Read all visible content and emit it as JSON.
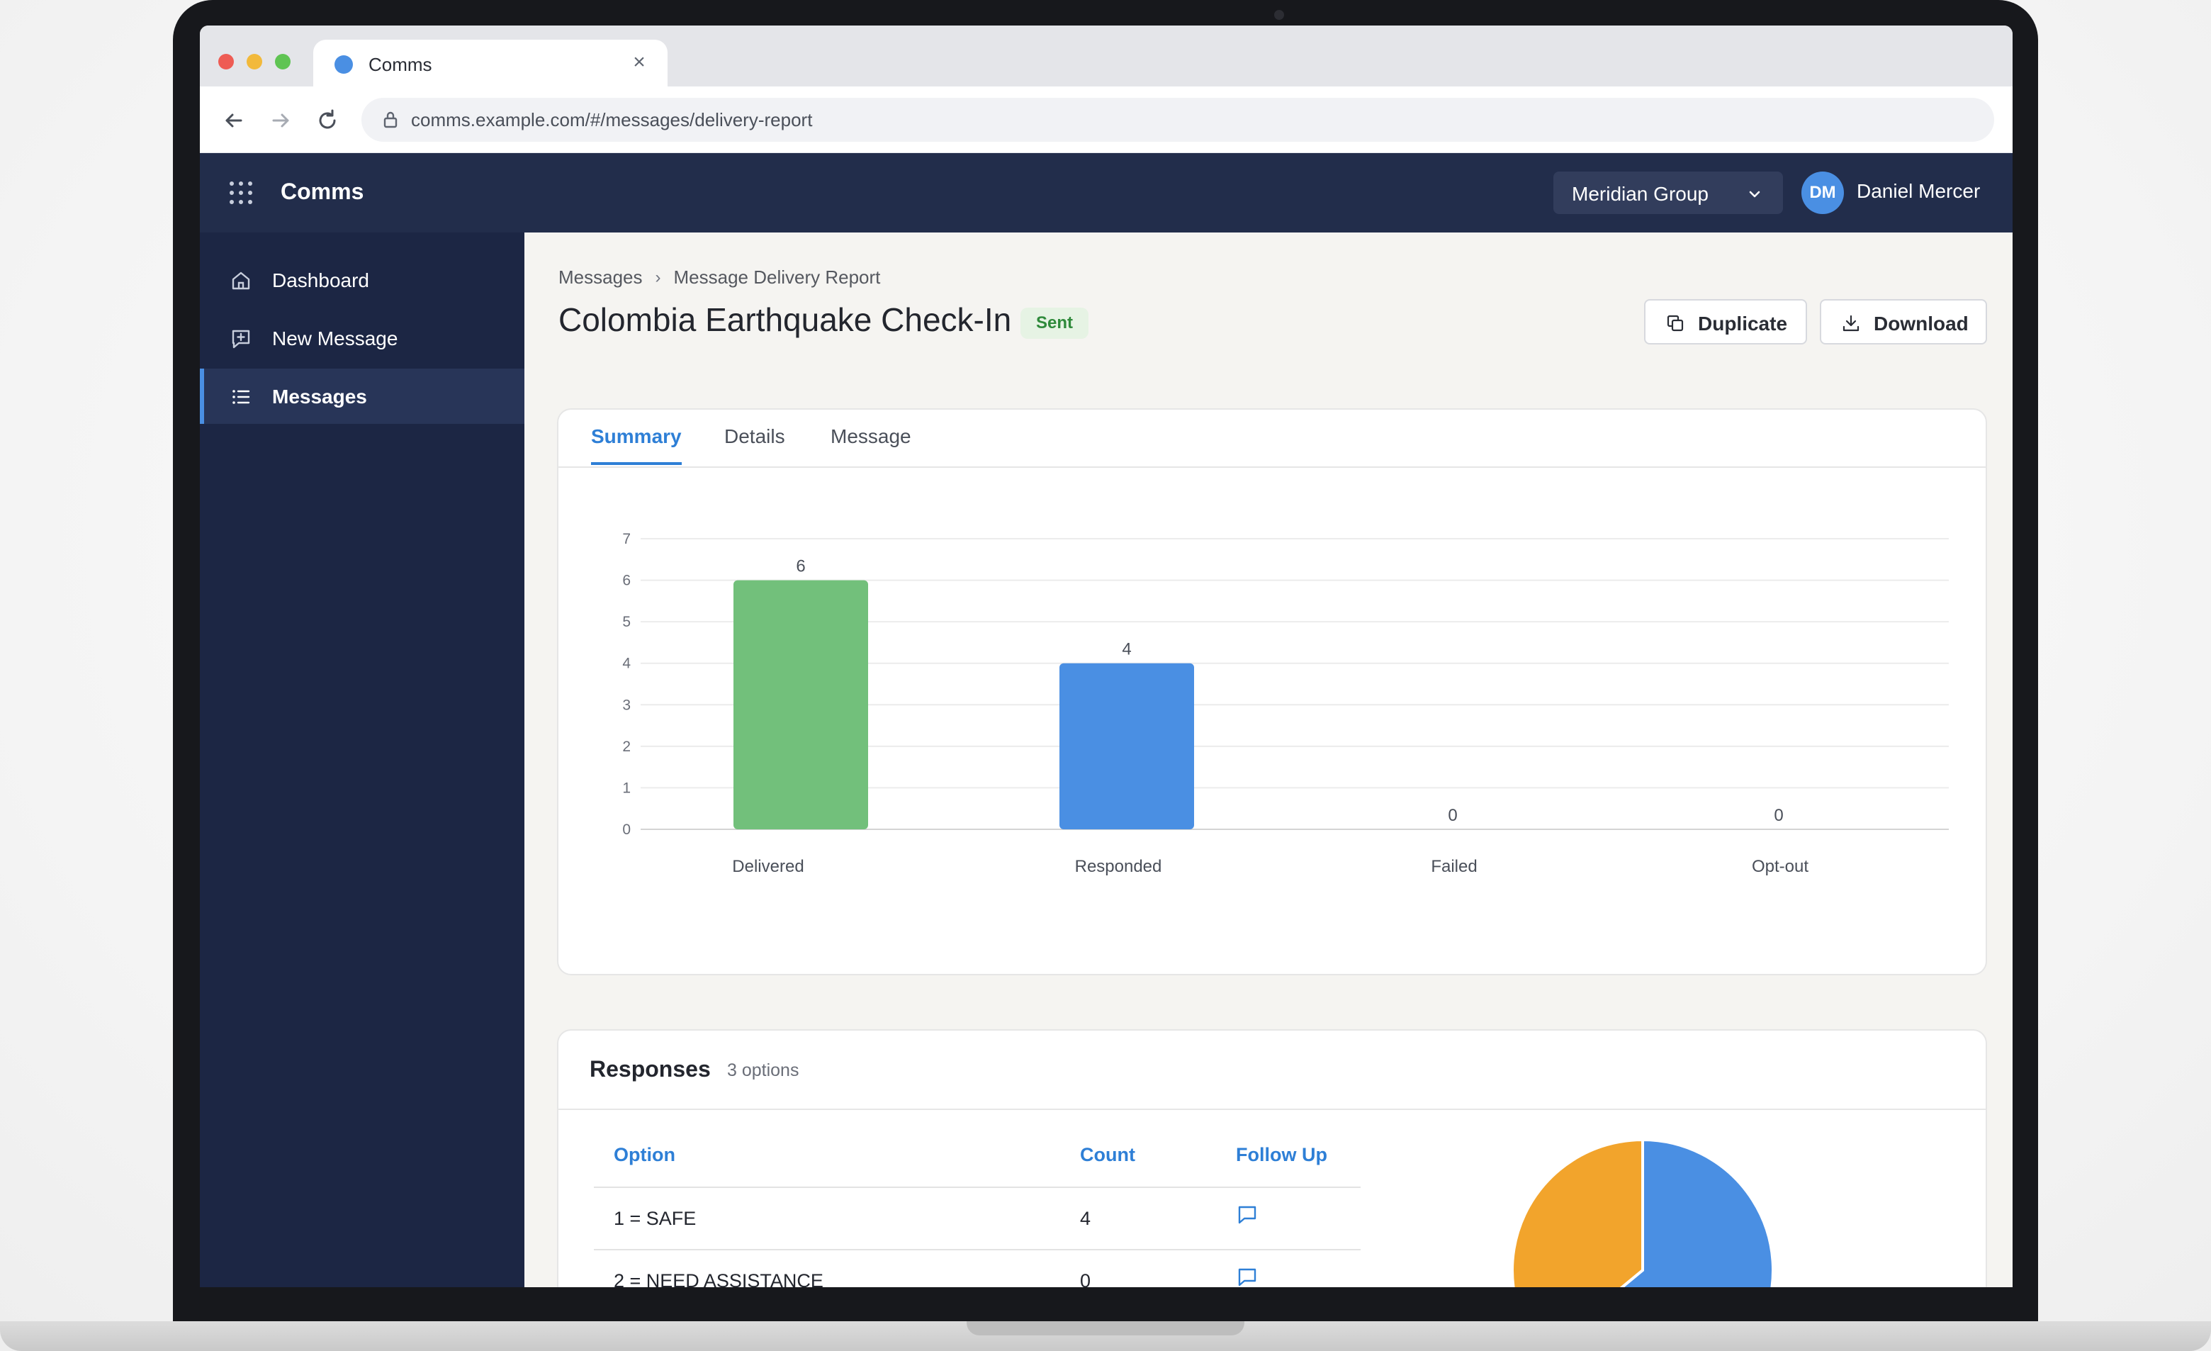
{
  "browser": {
    "tab_title": "Comms",
    "url": "comms.example.com/#/messages/delivery-report"
  },
  "header": {
    "app_name": "Comms",
    "org": "Meridian Group",
    "user_initials": "DM",
    "user_name": "Daniel Mercer"
  },
  "sidebar": {
    "items": [
      {
        "label": "Dashboard",
        "icon": "home-icon",
        "active": false
      },
      {
        "label": "New Message",
        "icon": "message-plus-icon",
        "active": false
      },
      {
        "label": "Messages",
        "icon": "list-icon",
        "active": true
      }
    ]
  },
  "page": {
    "breadcrumb": [
      "Messages",
      "Message Delivery Report"
    ],
    "breadcrumb_separator": "›",
    "title": "Colombia Earthquake Check-In",
    "status": "Sent",
    "actions": {
      "duplicate": "Duplicate",
      "download": "Download"
    },
    "tabs": [
      "Summary",
      "Details",
      "Message"
    ],
    "active_tab": "Summary"
  },
  "chart_data": [
    {
      "type": "bar",
      "categories": [
        "Delivered",
        "Responded",
        "Failed",
        "Opt-out"
      ],
      "values": [
        6,
        4,
        0,
        0
      ],
      "colors": [
        "#72c07b",
        "#4a8fe3",
        "#4a8fe3",
        "#4a8fe3"
      ],
      "ylim": [
        0,
        7
      ],
      "yticks": [
        0,
        1,
        2,
        3,
        4,
        5,
        6,
        7
      ],
      "grid": true
    },
    {
      "type": "pie",
      "categories": [
        "1 = SAFE",
        "2 = NEED ASSISTANCE"
      ],
      "values": [
        4,
        0
      ],
      "colors": [
        "#4a8fe3",
        "#f2a42c"
      ],
      "partially_visible": true
    }
  ],
  "responses": {
    "title": "Responses",
    "count_label": "3 options",
    "columns": [
      "Option",
      "Count",
      "Follow Up"
    ],
    "rows": [
      {
        "option": "1 = SAFE",
        "count": "4"
      },
      {
        "option": "2 = NEED ASSISTANCE",
        "count": "0"
      }
    ]
  },
  "colors": {
    "header_bg": "#222d4b",
    "sidebar_bg": "#1c2644",
    "accent": "#2e7fd6",
    "delivered": "#72c07b",
    "responded": "#4a8fe3",
    "pie_secondary": "#f2a42c",
    "status_sent_bg": "#e6f3e4",
    "status_sent_text": "#2f8a3b"
  }
}
